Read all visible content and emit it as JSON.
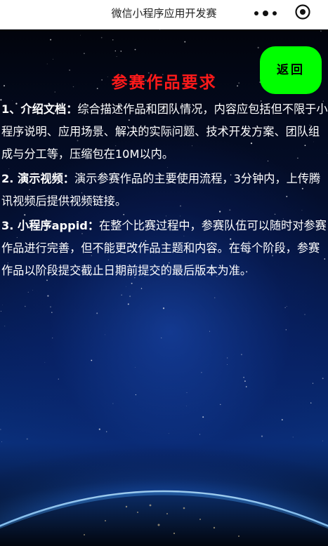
{
  "navbar": {
    "title": "微信小程序应用开发赛",
    "more_icon": "more-dots-icon",
    "close_icon": "target-circle-icon"
  },
  "page": {
    "back_label": "返回",
    "title": "参赛作品要求",
    "colors": {
      "title": "#ff1a1a",
      "back_button": "#00ff00",
      "text": "#ffffff"
    }
  },
  "requirements": [
    {
      "lead": "1、介绍文档：",
      "body": "综合描述作品和团队情况，内容应包括但不限于小程序说明、应用场景、解决的实际问题、技术开发方案、团队组成与分工等，压缩包在10M以内。"
    },
    {
      "lead": "2. 演示视频：",
      "body": "演示参赛作品的主要使用流程，3分钟内，上传腾讯视频后提供视频链接。"
    },
    {
      "lead": "3. 小程序appid：",
      "body": "在整个比赛过程中，参赛队伍可以随时对参赛作品进行完善，但不能更改作品主题和内容。在每个阶段，参赛作品以阶段提交截止日期前提交的最后版本为准。"
    }
  ],
  "background": {
    "image": "space-earth-night-image"
  }
}
